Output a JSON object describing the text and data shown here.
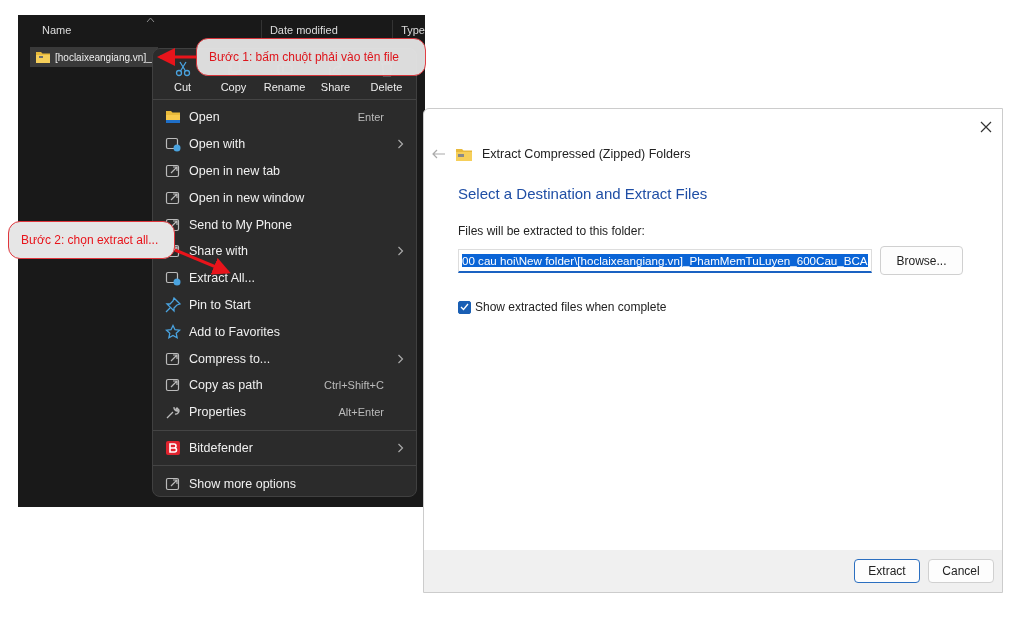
{
  "explorer": {
    "columns": [
      "Name",
      "Date modified",
      "Type"
    ],
    "file": {
      "name": "[hoclaixeangiang.vn]_",
      "selected": true
    }
  },
  "context_menu": {
    "toolbar": [
      "Cut",
      "Copy",
      "Rename",
      "Share",
      "Delete"
    ],
    "groups": [
      [
        {
          "label": "Open",
          "shortcut": "Enter",
          "submenu": false
        },
        {
          "label": "Open with",
          "submenu": true
        },
        {
          "label": "Open in new tab",
          "submenu": false
        },
        {
          "label": "Open in new window",
          "submenu": false
        },
        {
          "label": "Send to My Phone",
          "submenu": false
        },
        {
          "label": "Share with",
          "submenu": true
        },
        {
          "label": "Extract All...",
          "submenu": false
        },
        {
          "label": "Pin to Start",
          "submenu": false
        },
        {
          "label": "Add to Favorites",
          "submenu": false
        },
        {
          "label": "Compress to...",
          "submenu": true
        },
        {
          "label": "Copy as path",
          "shortcut": "Ctrl+Shift+C",
          "submenu": false
        },
        {
          "label": "Properties",
          "shortcut": "Alt+Enter",
          "submenu": false
        }
      ],
      [
        {
          "label": "Bitdefender",
          "submenu": true
        }
      ],
      [
        {
          "label": "Show more options",
          "submenu": false
        }
      ]
    ]
  },
  "callouts": [
    "Bước 1: bấm chuột phải vào tên file",
    "Bước 2: chọn extract all..."
  ],
  "dialog": {
    "title": "Extract Compressed (Zipped) Folders",
    "heading": "Select a Destination and Extract Files",
    "field_label": "Files will be extracted to this folder:",
    "path": "00 cau hoi\\New folder\\[hoclaixeangiang.vn]_PhamMemTuLuyen_600Cau_BCA",
    "browse": "Browse...",
    "checkbox": {
      "label": "Show extracted files when complete",
      "checked": true
    },
    "buttons": [
      {
        "label": "Extract",
        "default": true
      },
      {
        "label": "Cancel",
        "default": false
      }
    ]
  }
}
